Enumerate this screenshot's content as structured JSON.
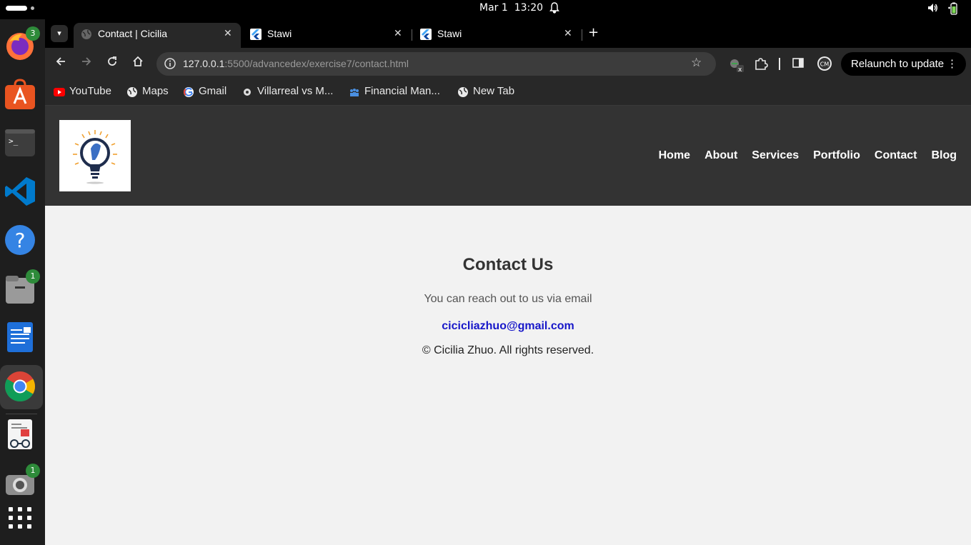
{
  "system": {
    "date": "Mar 1",
    "time": "13:20"
  },
  "dock": {
    "badges": {
      "firefox": "3",
      "files": "1",
      "screenshot": "1"
    },
    "apps": [
      "firefox-icon",
      "app-center-icon",
      "terminal-icon",
      "vscode-icon",
      "help-icon",
      "files-icon",
      "writer-icon",
      "chrome-icon",
      "document-viewer-icon",
      "screenshot-icon",
      "show-apps-icon"
    ]
  },
  "browser": {
    "tabs": [
      {
        "title": "Contact | Cicilia",
        "active": true
      },
      {
        "title": "Stawi",
        "active": false
      },
      {
        "title": "Stawi",
        "active": false
      }
    ],
    "url": {
      "host": "127.0.0.1",
      "rest": ":5500/advancedex/exercise7/contact.html"
    },
    "relaunch_label": "Relaunch to update",
    "profile_initials": "CM",
    "bookmarks": [
      {
        "label": "YouTube",
        "icon": "youtube-icon"
      },
      {
        "label": "Maps",
        "icon": "globe-icon"
      },
      {
        "label": "Gmail",
        "icon": "google-icon"
      },
      {
        "label": "Villarreal vs M...",
        "icon": "soccer-icon"
      },
      {
        "label": "Financial Man...",
        "icon": "people-icon"
      },
      {
        "label": "New Tab",
        "icon": "globe-icon"
      }
    ]
  },
  "site": {
    "nav": [
      "Home",
      "About",
      "Services",
      "Portfolio",
      "Contact",
      "Blog"
    ],
    "heading": "Contact Us",
    "subtext": "You can reach out to us via email",
    "email": "cicicliazhuo@gmail.com",
    "copyright": "© Cicilia Zhuo. All rights reserved."
  },
  "colors": {
    "header_bg": "#333333",
    "page_bg": "#f2f2f2",
    "link": "#1717c9"
  }
}
